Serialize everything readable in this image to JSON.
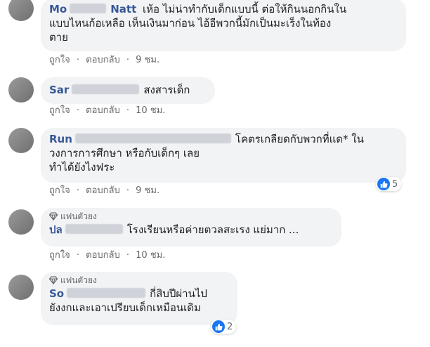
{
  "comments": [
    {
      "author": "Mo",
      "author_tail": "Natt",
      "text": "เห้อ ไม่น่าทำกับเด็กแบบนี้ ต่อให้กินนอกกินใน แบบไหนก้อเหลือ เห็นเงินมาก่อน ไอ้อีพวกนี้มักเป็นมะเร็งในท้องตาย",
      "line1": "เห้อ ไม่น่าทำกับเด็กแบบนี้ ต่อให้กินนอกกินใน",
      "line2": "แบบไหนก้อเหลือ เห็นเงินมาก่อน ไอ้อีพวกนี้มักเป็นมะเร็งในท้อง",
      "line3": "ตาย",
      "like": "ถูกใจ",
      "reply": "ตอบกลับ",
      "time": "9 ชม."
    },
    {
      "author": "Sar",
      "text": "สงสารเด็ก",
      "like": "ถูกใจ",
      "reply": "ตอบกลับ",
      "time": "10 ชม."
    },
    {
      "author": "Run",
      "line1": "โคตรเกลียดกับพวกที่แด* ใน",
      "line2": "วงการการศึกษา หรือกับเด็กๆ เลย",
      "line3": "ทำได้ยังไงฟระ",
      "like": "ถูกใจ",
      "reply": "ตอบกลับ",
      "time": "9 ชม.",
      "reaction_count": "5"
    },
    {
      "badge": "แฟนตัวยง",
      "author": "ปล",
      "text": "โรงเรียนหรือค่ายตวลสะเรง แย่มาก ...",
      "like": "ถูกใจ",
      "reply": "ตอบกลับ",
      "time": "10 ชม."
    },
    {
      "badge": "แฟนตัวยง",
      "author": "So",
      "line1": "กี่สิบปีผ่านไป",
      "line2": "ยังงกและเอาเปรียบเด็กเหมือนเดิม",
      "reaction_count": "2"
    }
  ],
  "separator": "·",
  "colors": {
    "bubble": "#f2f3f5",
    "author": "#385898",
    "meta": "#65676b",
    "like_blue": "#1877f2"
  },
  "icons": {
    "badge": "diamond-icon",
    "reaction": "thumbs-up-icon"
  }
}
